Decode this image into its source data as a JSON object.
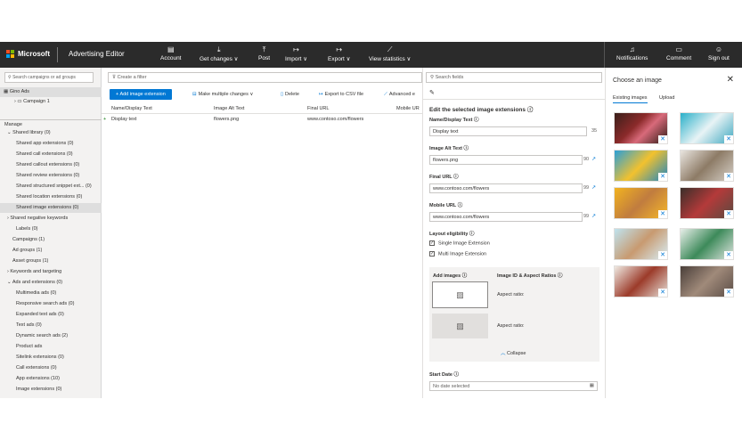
{
  "topbar": {
    "brand": "Microsoft",
    "app_title": "Advertising Editor",
    "items": [
      {
        "label": "Account",
        "icon": "account-icon"
      },
      {
        "label": "Get changes ∨",
        "icon": "download-icon"
      },
      {
        "label": "Post",
        "icon": "upload-icon"
      },
      {
        "label": "Import ∨",
        "icon": "import-icon"
      },
      {
        "label": "Export ∨",
        "icon": "export-icon"
      },
      {
        "label": "View statistics ∨",
        "icon": "chart-icon"
      }
    ],
    "right_items": [
      {
        "label": "Notifications",
        "icon": "bell-icon"
      },
      {
        "label": "Comment",
        "icon": "comment-icon"
      },
      {
        "label": "Sign out",
        "icon": "person-icon"
      }
    ]
  },
  "left": {
    "search_placeholder": "Search campaigns or ad groups",
    "account": "Gino Ads",
    "campaign": "Campaign 1",
    "manage": "Manage",
    "tree": [
      "Shared library (0)",
      "Shared app extensions (0)",
      "Shared call extensions (0)",
      "Shared callout extensions (0)",
      "Shared review extensions (0)",
      "Shared structured snippet ext... (0)",
      "Shared location extensions (0)",
      "Shared image extensions (0)",
      "Shared negative keywords",
      "Labels (0)",
      "Campaigns (1)",
      "Ad groups (1)",
      "Asset groups (1)",
      "Keywords and targeting",
      "Ads and extensions (0)",
      "Multimedia ads (0)",
      "Responsive search ads (0)",
      "Expanded text ads (0)",
      "Text ads (0)",
      "Dynamic search ads (2)",
      "Product ads",
      "Sitelink extensions (0)",
      "Call extensions (0)",
      "App extensions (10)",
      "Image extensions (0)"
    ]
  },
  "center": {
    "filter_placeholder": "Create a filter",
    "add_button": "Add image extension",
    "tools": [
      "Make multiple changes ∨",
      "Delete",
      "Export to CSV file",
      "Advanced e"
    ],
    "columns": [
      "Name/Display Text",
      "Image Alt Text",
      "Final URL",
      "Mobile UR"
    ],
    "row": [
      "Display text",
      "flowers.png",
      "www.contoso.com/flowers",
      ""
    ]
  },
  "edit": {
    "search_placeholder": "Search fields",
    "title": "Edit the selected image extensions",
    "name_label": "Name/Display Text",
    "name_value": "Display text",
    "name_count": "35",
    "alt_label": "Image Alt Text",
    "alt_value": "flowers.png",
    "alt_count": "90",
    "final_label": "Final URL",
    "final_value": "www.contoso.com/flowers",
    "final_count": "99",
    "mobile_label": "Mobile URL",
    "mobile_value": "www.contoso.com/flowers",
    "mobile_count": "99",
    "layout_label": "Layout eligibility",
    "single": "Single Image Extension",
    "multi": "Multi Image Extension",
    "add_images": "Add images",
    "image_id": "Image ID & Aspect Ratios",
    "aspect1": "Aspect ratio:",
    "aspect2": "Aspect ratio:",
    "collapse": "Collapse",
    "start_label": "Start Date",
    "start_placeholder": "No date selected"
  },
  "picker": {
    "title": "Choose an image",
    "tabs": [
      "Existing images",
      "Upload"
    ],
    "images": [
      "flowers",
      "cat",
      "dog-yellow",
      "cat-window",
      "puppy-orange",
      "dog-black",
      "kitten-jump",
      "plant-pot",
      "camera-red",
      "cat-gray"
    ]
  },
  "colors": {
    "accent": "#0078d4",
    "topbar": "#2b2b2b"
  }
}
